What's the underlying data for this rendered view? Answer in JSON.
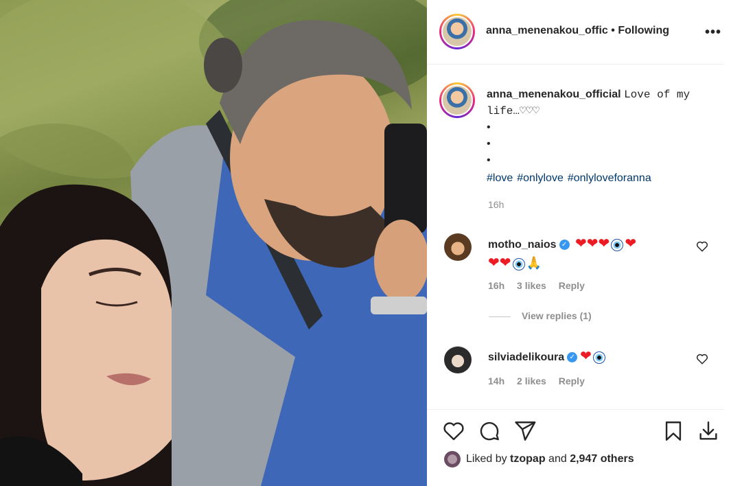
{
  "header": {
    "username": "anna_menenakou_offic",
    "separator": "•",
    "follow_status": "Following",
    "more_label": "•••"
  },
  "caption": {
    "username": "anna_menenakou_official",
    "text_line1": "Love of my",
    "text_line2": "life…♡♡♡",
    "dots": [
      "•",
      "•",
      "•"
    ],
    "hashtags": [
      "#love",
      "#onlylove",
      "#onlyloveforanna"
    ],
    "time": "16h"
  },
  "comments": [
    {
      "username": "motho_naios",
      "verified_mark": "✓",
      "time": "16h",
      "likes": "3 likes",
      "reply": "Reply",
      "view_replies": "View replies (1)"
    },
    {
      "username": "silviadelikoura",
      "verified_mark": "✓",
      "time": "14h",
      "likes": "2 likes",
      "reply": "Reply"
    }
  ],
  "footer": {
    "liked_by_prefix": "Liked by",
    "liked_by_user": "tzopap",
    "and": "and",
    "others": "2,947 others"
  },
  "icons": {
    "heart": "heart-icon",
    "comment": "comment-icon",
    "share": "share-icon",
    "save": "bookmark-icon",
    "download": "download-icon"
  },
  "colors": {
    "link": "#00376b",
    "muted": "#8e8e8e",
    "verified": "#3897f0",
    "heart": "#ed1c24"
  }
}
